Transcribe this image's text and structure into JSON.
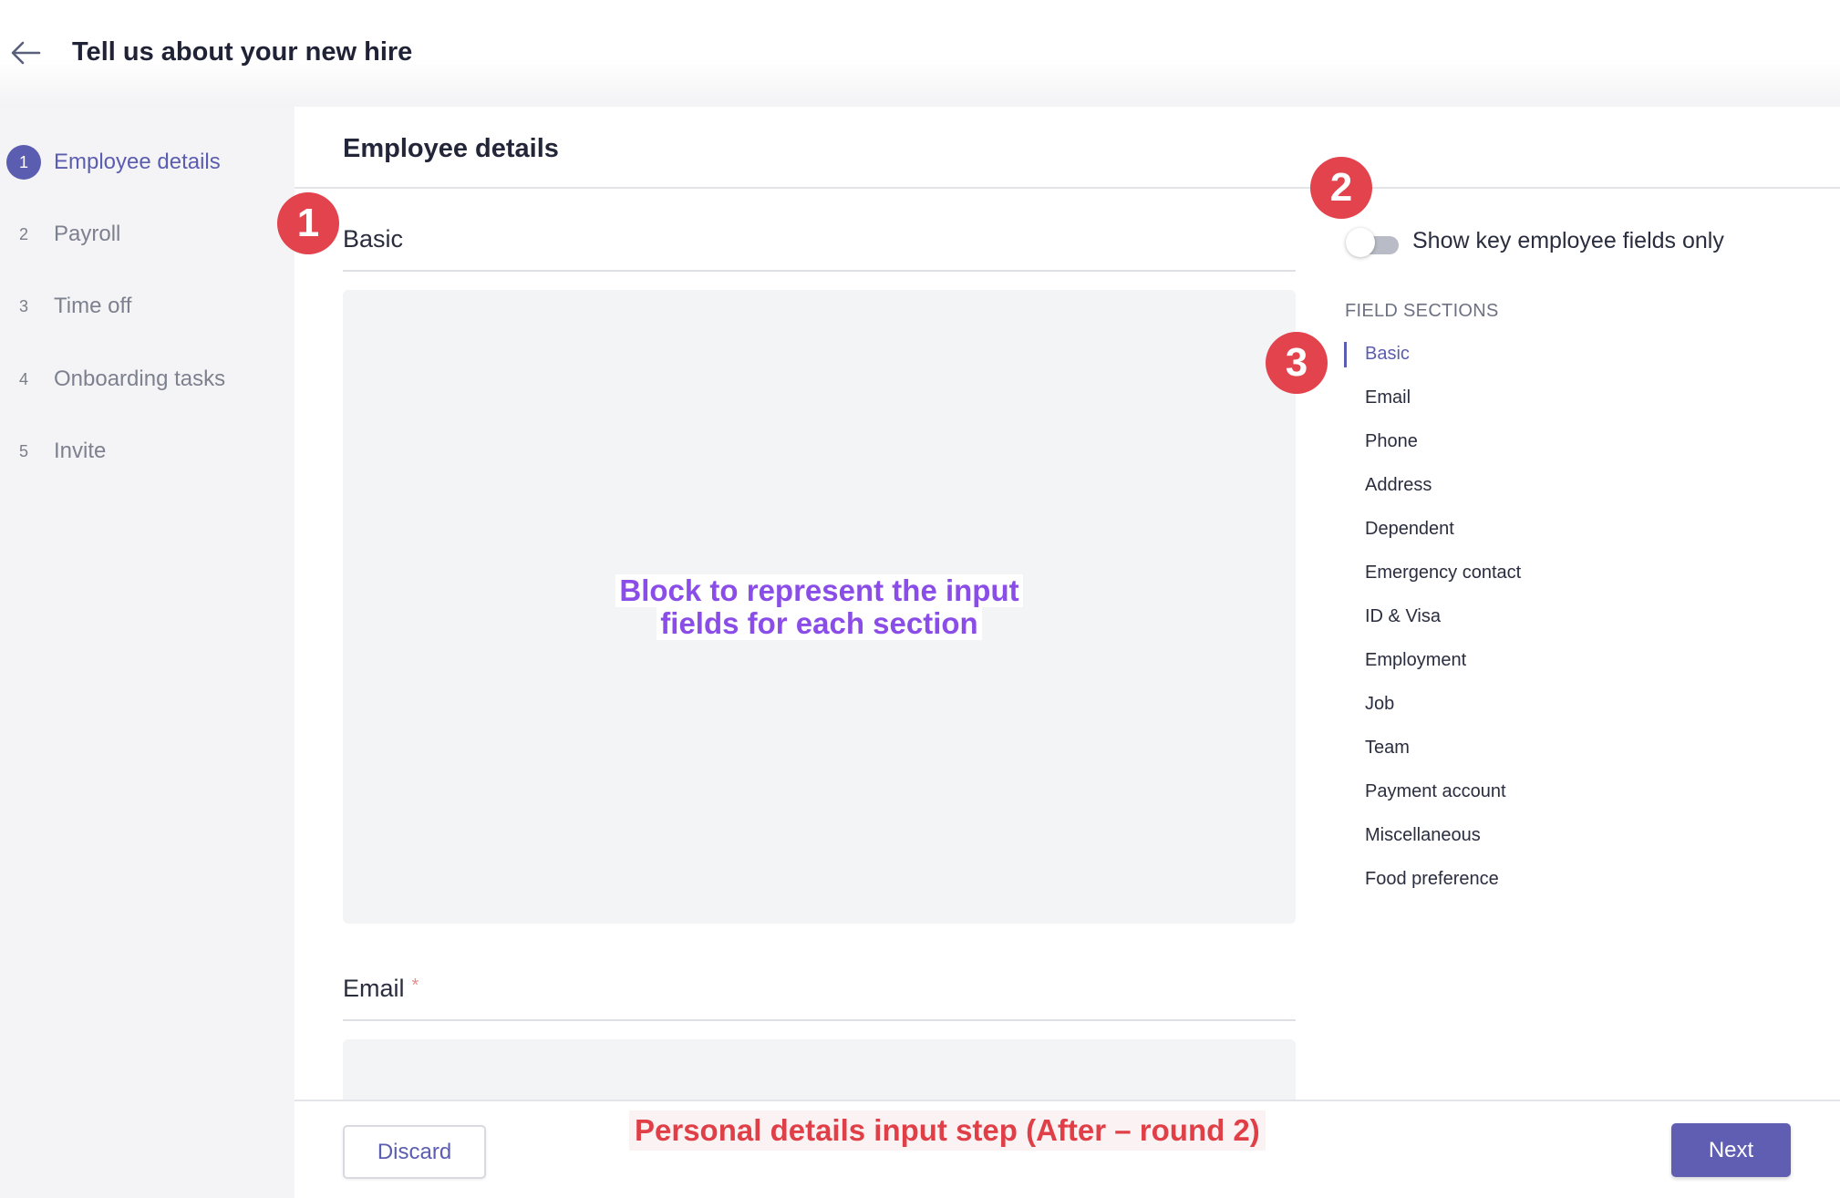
{
  "header": {
    "title": "Tell us about your new hire",
    "back_icon": "arrow-left-icon"
  },
  "steps": [
    {
      "number": "1",
      "label": "Employee details",
      "active": true
    },
    {
      "number": "2",
      "label": "Payroll",
      "active": false
    },
    {
      "number": "3",
      "label": "Time off",
      "active": false
    },
    {
      "number": "4",
      "label": "Onboarding tasks",
      "active": false
    },
    {
      "number": "5",
      "label": "Invite",
      "active": false
    }
  ],
  "main": {
    "heading": "Employee details",
    "groups": [
      {
        "title": "Basic",
        "required": false,
        "required_mark": ""
      },
      {
        "title": "Email",
        "required": true,
        "required_mark": "*"
      }
    ],
    "block_note": {
      "line1": "Block to represent the input",
      "line2": "fields for each section"
    }
  },
  "right_panel": {
    "toggle": {
      "label": "Show key employee fields only",
      "on": false
    },
    "sections_title": "FIELD SECTIONS",
    "active_section": "Basic",
    "sections": [
      "Basic",
      "Email",
      "Phone",
      "Address",
      "Dependent",
      "Emergency contact",
      "ID & Visa",
      "Employment",
      "Job",
      "Team",
      "Payment account",
      "Miscellaneous",
      "Food preference"
    ]
  },
  "footer": {
    "discard_label": "Discard",
    "next_label": "Next"
  },
  "annotations": {
    "markers": [
      "1",
      "2",
      "3"
    ],
    "caption": "Personal details input step (After – round 2)"
  },
  "colors": {
    "accent": "#5b5db0",
    "sidebar_bg": "#f4f4f6",
    "block_bg": "#f3f4f6",
    "annotation_red": "#e2434c",
    "note_purple": "#8a4de8"
  }
}
